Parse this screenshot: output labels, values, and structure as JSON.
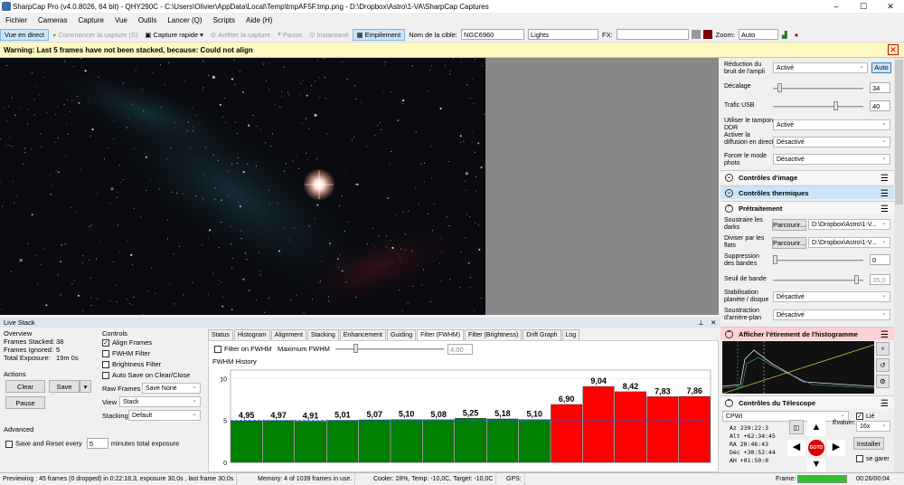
{
  "window": {
    "title": "SharpCap Pro (v4.0.8026, 64 bit) - QHY290C - C:\\Users\\Olivier\\AppData\\Local\\Temp\\tmpAF5F.tmp.png - D:\\Dropbox\\Astro\\1-VA\\SharpCap Captures"
  },
  "menu": [
    "Fichier",
    "Cameras",
    "Capture",
    "Vue",
    "Outils",
    "Lancer (Q)",
    "Scripts",
    "Aide (H)"
  ],
  "toolbar": {
    "live_view": "Vue en direct",
    "start_capture": "Commencer la capture (S)",
    "quick_capture": "Capture rapide",
    "stop_capture": "Arrêter la capture",
    "pause": "Pause",
    "snapshot": "Instantané",
    "stack": "Empilement",
    "target_label": "Nom de la cible:",
    "target_value": "NGC6960",
    "frame_type": "Lights",
    "fx_label": "FX:",
    "zoom_label": "Zoom:",
    "zoom_value": "Auto"
  },
  "warning": {
    "text": "Warning: Last 5 frames have not been stacked, because: Could not align"
  },
  "right_panel": {
    "noise_label": "Réduction du bruit de l'ampli",
    "noise_value": "Activé",
    "noise_auto": "Auto",
    "offset_label": "Décalage",
    "offset_value": "34",
    "usb_label": "Trafic USB",
    "usb_value": "40",
    "ddr_label": "Utiliser le tampon DDR",
    "ddr_value": "Activé",
    "diffusion_label": "Activer la diffusion en direct",
    "diffusion_value": "Désactivé",
    "photo_label": "Forcer le mode photo",
    "photo_value": "Désactivé",
    "sec_image": "Contrôles d'image",
    "sec_thermal": "Contrôles thermiques",
    "sec_pre": "Prétraitement",
    "darks_label": "Soustraire les darks",
    "darks_btn": "Parcourir...",
    "darks_path": "D:\\Dropbox\\Astro\\1-V...",
    "flats_label": "Diviser par les flats",
    "flats_btn": "Parcourir...",
    "flats_path": "D:\\Dropbox\\Astro\\1-V...",
    "banding_label": "Suppression des bandes",
    "banding_value": "0",
    "band_thresh_label": "Seuil de bande",
    "band_thresh_value": "35,0",
    "stab_label": "Stabilisation planète / disque",
    "stab_value": "Désactivé",
    "bg_label": "Soustraction d'arrière-plan",
    "bg_value": "Désactivé",
    "sec_hist": "Afficher l'étirement de l'histogramme",
    "sec_scope": "Contrôles du Télescope",
    "scope_name": "CPWI",
    "scope_linked": "Lié",
    "evaluate_label": "Évaluer:",
    "evaluate_value": "16x",
    "install_btn": "Installer",
    "park_label": "se garer",
    "goto_label": "GOTO",
    "tel_rows": [
      "Az   239:22:3",
      "Alt  +62:34:45",
      "RA    20:46:43",
      "Déc  +30:52:44",
      "AH   +01:50:0"
    ]
  },
  "live_stack": {
    "title": "Live Stack",
    "overview": "Overview",
    "frames_stacked_label": "Frames Stacked:",
    "frames_stacked": "38",
    "frames_ignored_label": "Frames Ignored:",
    "frames_ignored": "5",
    "total_exposure_label": "Total Exposure:",
    "total_exposure": "19m 0s",
    "actions": "Actions",
    "clear": "Clear",
    "save": "Save",
    "pause": "Pause",
    "advanced": "Advanced",
    "save_reset_label": "Save and Reset every",
    "save_reset_value": "5",
    "save_reset_suffix": "minutes total exposure",
    "controls": "Controls",
    "align_frames": "Align Frames",
    "fwhm_filter": "FWHM Filter",
    "brightness_filter": "Brightness Filter",
    "auto_save": "Auto Save on Clear/Close",
    "raw_frames_label": "Raw Frames",
    "raw_frames_value": "Save None",
    "view_label": "View",
    "view_value": "Stack",
    "stacking_label": "Stacking",
    "stacking_value": "Default",
    "tabs": [
      "Status",
      "Histogram",
      "Alignment",
      "Stacking",
      "Enhancement",
      "Guiding",
      "Filter (FWHM)",
      "Filter (Brightness)",
      "Drift Graph",
      "Log"
    ],
    "filter_on_fwhm": "Filter on FWHM",
    "max_fwhm_label": "Maximum FWHM",
    "max_fwhm_value": "4.00",
    "history_title": "FWHM History"
  },
  "chart_data": {
    "type": "bar",
    "title": "FWHM History",
    "xlabel": "",
    "ylabel": "",
    "ylim": [
      0,
      11
    ],
    "yticks": [
      0,
      5,
      10
    ],
    "values": [
      4.95,
      4.97,
      4.91,
      5.01,
      5.07,
      5.1,
      5.08,
      5.25,
      5.18,
      5.1,
      6.9,
      9.04,
      8.42,
      7.83,
      7.86
    ],
    "labels": [
      "4,95",
      "4,97",
      "4,91",
      "5,01",
      "5,07",
      "5,10",
      "5,08",
      "5,25",
      "5,18",
      "5,10",
      "6,90",
      "9,04",
      "8,42",
      "7,83",
      "7,86"
    ],
    "colors": [
      "#008000",
      "#008000",
      "#008000",
      "#008000",
      "#008000",
      "#008000",
      "#008000",
      "#008000",
      "#008000",
      "#008000",
      "#ff0000",
      "#ff0000",
      "#ff0000",
      "#ff0000",
      "#ff0000"
    ],
    "threshold": 5,
    "grid": true
  },
  "status": {
    "preview": "Previewing : 45 frames (0 dropped) in 0:22:18,3, exposure 30,0s , last frame 30,0s",
    "memory": "Memory: 4 of 1039 frames in use.",
    "cooler": "Cooler: 28%, Temp: -10,0C, Target: -10,0C",
    "gps": "GPS:",
    "frame_label": "Frame:",
    "time": "00:26/00:04"
  }
}
